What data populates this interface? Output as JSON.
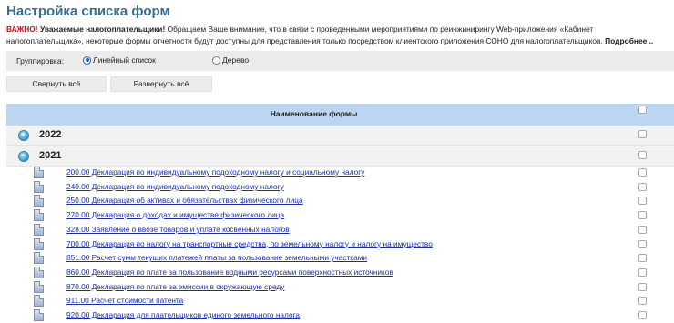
{
  "page": {
    "title": "Настройка списка форм"
  },
  "notice": {
    "warn": "ВАЖНО!",
    "bold": "Уважаемые налогоплательщики!",
    "text": "Обращаем Ваше внимание, что в связи с проведенными мероприятиями по реинжинирингу Web-приложения «Кабинет налогоплательщика», некоторые формы отчетности будут доступны для представления только посредством клиентского приложения СОНО для налогоплательщиков.",
    "more": "Подробнее..."
  },
  "grouping": {
    "label": "Группировка:",
    "options": [
      {
        "label": "Линейный список",
        "selected": true
      },
      {
        "label": "Дерево",
        "selected": false
      }
    ]
  },
  "buttons": {
    "collapse_all": "Свернуть всё",
    "expand_all": "Развернуть всё"
  },
  "table": {
    "header": "Наименование формы",
    "groups": [
      {
        "year": "2022",
        "expanded": false
      },
      {
        "year": "2021",
        "expanded": true
      }
    ],
    "forms": [
      "200.00 Декларация по индивидуальному подоходному налогу и социальному налогу",
      "240.00 Декларация по индивидуальному подоходному налогу",
      "250.00 Декларация об активах и обязательствах физического лица",
      "270.00 Декларация о доходах и имуществе физического лица",
      "328.00 Заявление о ввозе товаров и уплате косвенных налогов",
      "700.00 Декларация по налогу на транспортные средства, по земельному налогу и налогу на имущество",
      "851.00 Расчет сумм текущих платежей платы за пользование земельными участками",
      "860.00 Декларация по плате за пользование водными ресурсами поверхностных источников",
      "870.00 Декларация по плате за эмиссии в окружающую среду",
      "911.00 Расчет стоимости патента",
      "920.00 Декларация для плательщиков единого земельного налога"
    ]
  }
}
